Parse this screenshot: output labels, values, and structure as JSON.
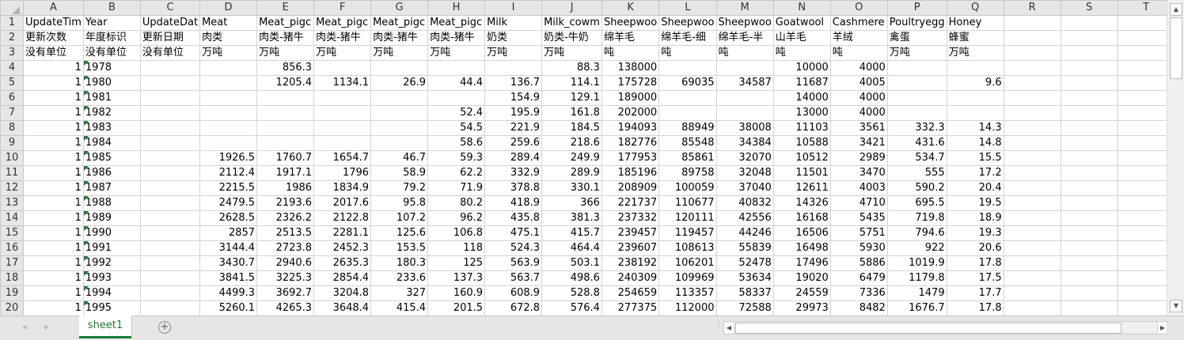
{
  "columns": [
    "A",
    "B",
    "C",
    "D",
    "E",
    "F",
    "G",
    "H",
    "I",
    "J",
    "K",
    "L",
    "M",
    "N",
    "O",
    "P",
    "Q",
    "R",
    "S",
    "T"
  ],
  "rows": [
    [
      "UpdateTim",
      "Year",
      "UpdateDat",
      "Meat",
      "Meat_pigc",
      "Meat_pigc",
      "Meat_pigc",
      "Meat_pigc",
      "Milk",
      "Milk_cowm",
      "Sheepwoo",
      "Sheepwoo",
      "Sheepwoo",
      "Goatwool",
      "Cashmere",
      "Poultryegg",
      "Honey"
    ],
    [
      "更新次数",
      "年度标识",
      "更新日期",
      "肉类",
      "肉类-猪牛",
      "肉类-猪牛",
      "肉类-猪牛",
      "肉类-猪牛",
      "奶类",
      "奶类-牛奶",
      "绵羊毛",
      "绵羊毛-细",
      "绵羊毛-半",
      "山羊毛",
      "羊绒",
      "禽蛋",
      "蜂蜜"
    ],
    [
      "没有单位",
      "没有单位",
      "没有单位",
      "万吨",
      "万吨",
      "万吨",
      "万吨",
      "万吨",
      "万吨",
      "万吨",
      "吨",
      "吨",
      "吨",
      "吨",
      "吨",
      "万吨",
      "万吨"
    ],
    [
      "1",
      "1978",
      "",
      "",
      "856.3",
      "",
      "",
      "",
      "",
      "88.3",
      "138000",
      "",
      "",
      "10000",
      "4000",
      "",
      ""
    ],
    [
      "1",
      "1980",
      "",
      "",
      "1205.4",
      "1134.1",
      "26.9",
      "44.4",
      "136.7",
      "114.1",
      "175728",
      "69035",
      "34587",
      "11687",
      "4005",
      "",
      "9.6"
    ],
    [
      "1",
      "1981",
      "",
      "",
      "",
      "",
      "",
      "",
      "154.9",
      "129.1",
      "189000",
      "",
      "",
      "14000",
      "4000",
      "",
      ""
    ],
    [
      "1",
      "1982",
      "",
      "",
      "",
      "",
      "",
      "52.4",
      "195.9",
      "161.8",
      "202000",
      "",
      "",
      "13000",
      "4000",
      "",
      ""
    ],
    [
      "1",
      "1983",
      "",
      "",
      "",
      "",
      "",
      "54.5",
      "221.9",
      "184.5",
      "194093",
      "88949",
      "38008",
      "11103",
      "3561",
      "332.3",
      "14.3"
    ],
    [
      "1",
      "1984",
      "",
      "",
      "",
      "",
      "",
      "58.6",
      "259.6",
      "218.6",
      "182776",
      "85548",
      "34384",
      "10588",
      "3421",
      "431.6",
      "14.8"
    ],
    [
      "1",
      "1985",
      "",
      "1926.5",
      "1760.7",
      "1654.7",
      "46.7",
      "59.3",
      "289.4",
      "249.9",
      "177953",
      "85861",
      "32070",
      "10512",
      "2989",
      "534.7",
      "15.5"
    ],
    [
      "1",
      "1986",
      "",
      "2112.4",
      "1917.1",
      "1796",
      "58.9",
      "62.2",
      "332.9",
      "289.9",
      "185196",
      "89758",
      "32048",
      "11501",
      "3470",
      "555",
      "17.2"
    ],
    [
      "1",
      "1987",
      "",
      "2215.5",
      "1986",
      "1834.9",
      "79.2",
      "71.9",
      "378.8",
      "330.1",
      "208909",
      "100059",
      "37040",
      "12611",
      "4003",
      "590.2",
      "20.4"
    ],
    [
      "1",
      "1988",
      "",
      "2479.5",
      "2193.6",
      "2017.6",
      "95.8",
      "80.2",
      "418.9",
      "366",
      "221737",
      "110677",
      "40832",
      "14326",
      "4710",
      "695.5",
      "19.5"
    ],
    [
      "1",
      "1989",
      "",
      "2628.5",
      "2326.2",
      "2122.8",
      "107.2",
      "96.2",
      "435.8",
      "381.3",
      "237332",
      "120111",
      "42556",
      "16168",
      "5435",
      "719.8",
      "18.9"
    ],
    [
      "1",
      "1990",
      "",
      "2857",
      "2513.5",
      "2281.1",
      "125.6",
      "106.8",
      "475.1",
      "415.7",
      "239457",
      "119457",
      "44246",
      "16506",
      "5751",
      "794.6",
      "19.3"
    ],
    [
      "1",
      "1991",
      "",
      "3144.4",
      "2723.8",
      "2452.3",
      "153.5",
      "118",
      "524.3",
      "464.4",
      "239607",
      "108613",
      "55839",
      "16498",
      "5930",
      "922",
      "20.6"
    ],
    [
      "1",
      "1992",
      "",
      "3430.7",
      "2940.6",
      "2635.3",
      "180.3",
      "125",
      "563.9",
      "503.1",
      "238192",
      "106201",
      "52478",
      "17496",
      "5886",
      "1019.9",
      "17.8"
    ],
    [
      "1",
      "1993",
      "",
      "3841.5",
      "3225.3",
      "2854.4",
      "233.6",
      "137.3",
      "563.7",
      "498.6",
      "240309",
      "109969",
      "53634",
      "19020",
      "6479",
      "1179.8",
      "17.5"
    ],
    [
      "1",
      "1994",
      "",
      "4499.3",
      "3692.7",
      "3204.8",
      "327",
      "160.9",
      "608.9",
      "528.8",
      "254659",
      "113357",
      "58337",
      "24559",
      "7336",
      "1479",
      "17.7"
    ],
    [
      "1",
      "1995",
      "",
      "5260.1",
      "4265.3",
      "3648.4",
      "415.4",
      "201.5",
      "672.8",
      "576.4",
      "277375",
      "112000",
      "72588",
      "29973",
      "8482",
      "1676.7",
      "17.8"
    ]
  ],
  "sheet_tab": "sheet1",
  "add_sheet_icon": "plus-circle-icon",
  "accent_color": "#1e7a38"
}
